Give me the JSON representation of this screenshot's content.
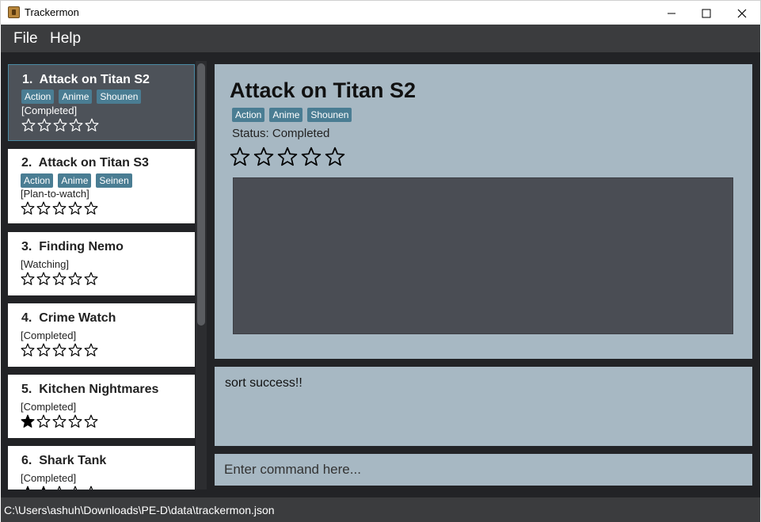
{
  "window": {
    "title": "Trackermon"
  },
  "menu": {
    "file": "File",
    "help": "Help"
  },
  "list": [
    {
      "index": "1.",
      "title": "Attack on Titan S2",
      "tags": [
        "Action",
        "Anime",
        "Shounen"
      ],
      "status": "[Completed]",
      "rating": 0
    },
    {
      "index": "2.",
      "title": "Attack on Titan S3",
      "tags": [
        "Action",
        "Anime",
        "Seinen"
      ],
      "status": "[Plan-to-watch]",
      "rating": 0
    },
    {
      "index": "3.",
      "title": "Finding Nemo",
      "tags": [],
      "status": "[Watching]",
      "rating": 0
    },
    {
      "index": "4.",
      "title": "Crime Watch",
      "tags": [],
      "status": "[Completed]",
      "rating": 0
    },
    {
      "index": "5.",
      "title": "Kitchen Nightmares",
      "tags": [],
      "status": "[Completed]",
      "rating": 1
    },
    {
      "index": "6.",
      "title": "Shark Tank",
      "tags": [],
      "status": "[Completed]",
      "rating": 2
    }
  ],
  "detail": {
    "title": "Attack on Titan S2",
    "tags": [
      "Action",
      "Anime",
      "Shounen"
    ],
    "status": "Status: Completed",
    "rating": 0
  },
  "result": {
    "text": "sort success!!"
  },
  "command": {
    "placeholder": "Enter command here..."
  },
  "statusbar": {
    "path": "C:\\Users\\ashuh\\Downloads\\PE-D\\data\\trackermon.json"
  },
  "colors": {
    "panel": "#a7b8c3",
    "tag": "#4a7d93",
    "background": "#222326",
    "selected_card": "#4d5259"
  }
}
